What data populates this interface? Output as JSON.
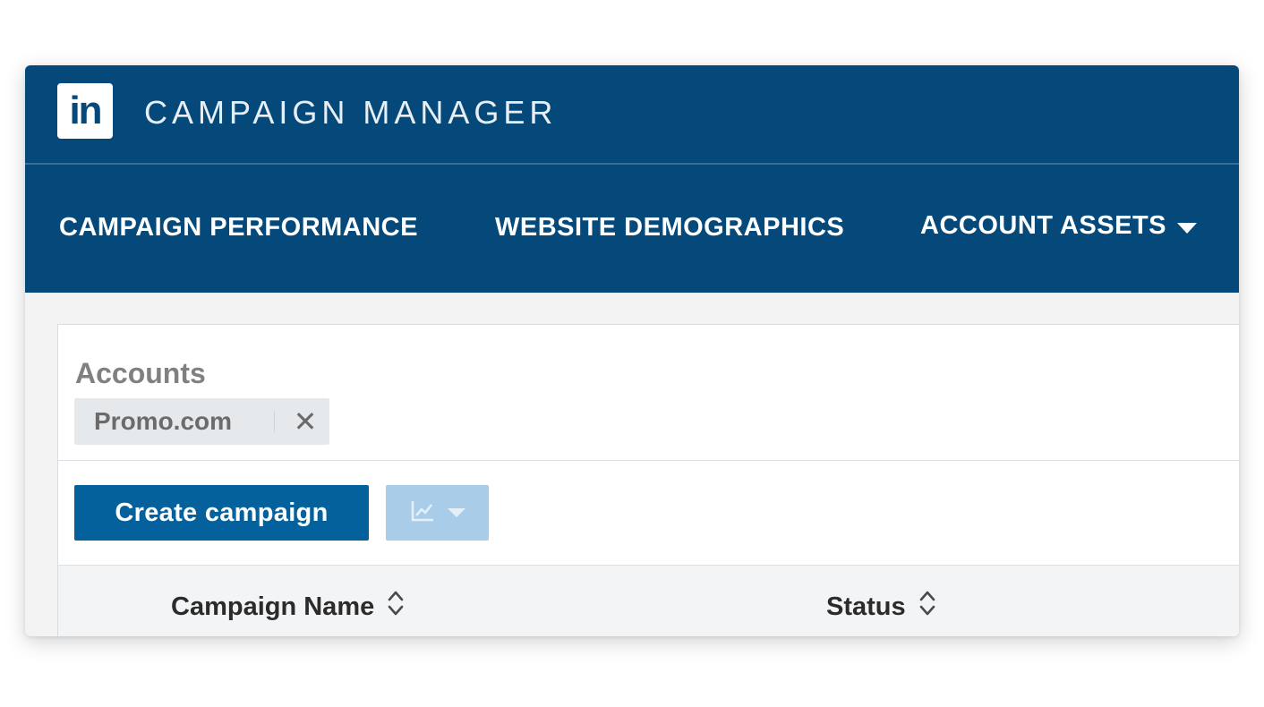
{
  "app": {
    "logo_text": "in",
    "title": "CAMPAIGN MANAGER",
    "brand_color": "#05497b"
  },
  "nav": {
    "items": [
      {
        "label": "CAMPAIGN PERFORMANCE"
      },
      {
        "label": "WEBSITE DEMOGRAPHICS"
      },
      {
        "label": "ACCOUNT ASSETS",
        "icon": "caret-down-icon"
      }
    ]
  },
  "accounts": {
    "label": "Accounts",
    "chips": [
      {
        "label": "Promo.com",
        "remove_icon": "close-icon",
        "remove_glyph": "✕"
      }
    ]
  },
  "toolbar": {
    "create_label": "Create campaign",
    "create_color": "#05619b",
    "chart_button_icon": "line-chart-icon",
    "chart_button_color": "#a9cde8"
  },
  "table": {
    "columns": [
      {
        "label": "Campaign Name",
        "sort_icon": "sort-icon"
      },
      {
        "label": "Status",
        "sort_icon": "sort-icon"
      }
    ]
  }
}
